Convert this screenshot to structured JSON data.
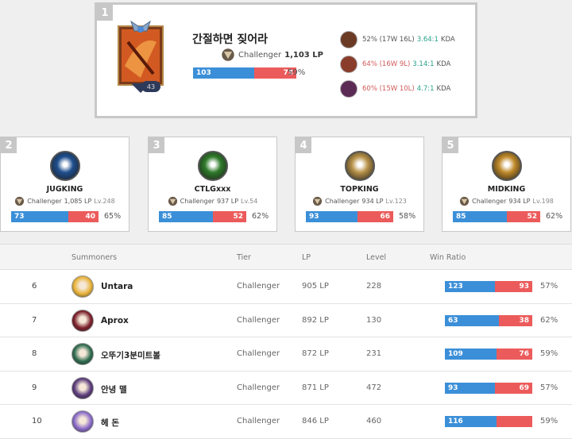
{
  "top1": {
    "rank": "1",
    "name": "간절하면 짖어라",
    "tier": "Challenger",
    "lp": "1,103 LP",
    "level": "43",
    "wins": "103",
    "losses": "73",
    "win_fraction": 0.585,
    "win_ratio": "59%",
    "most_played": [
      {
        "record": "52% (17W 16L)",
        "kda": "3.64:1",
        "kda_suffix": "KDA",
        "champ_color": "#6b3a24",
        "red": false
      },
      {
        "record": "64% (16W 9L)",
        "kda": "3.14:1",
        "kda_suffix": "KDA",
        "champ_color": "#8a3d2a",
        "red": true
      },
      {
        "record": "60% (15W 10L)",
        "kda": "4.7:1",
        "kda_suffix": "KDA",
        "champ_color": "#5b2a55",
        "red": true
      }
    ]
  },
  "top_cards": [
    {
      "rank": "2",
      "name": "JUGKING",
      "tier": "Challenger",
      "lp": "1,085 LP",
      "lv": "Lv.248",
      "wins": "73",
      "losses": "40",
      "win_fraction": 0.646,
      "win_ratio": "65%",
      "icon_color": "#1f4f8e"
    },
    {
      "rank": "3",
      "name": "CTLGxxx",
      "tier": "Challenger",
      "lp": "937 LP",
      "lv": "Lv.54",
      "wins": "85",
      "losses": "52",
      "win_fraction": 0.62,
      "win_ratio": "62%",
      "icon_color": "#2f7a2a"
    },
    {
      "rank": "4",
      "name": "TOPKING",
      "tier": "Challenger",
      "lp": "934 LP",
      "lv": "Lv.123",
      "wins": "93",
      "losses": "66",
      "win_fraction": 0.585,
      "win_ratio": "58%",
      "icon_color": "#b8934a"
    },
    {
      "rank": "5",
      "name": "MIDKING",
      "tier": "Challenger",
      "lp": "934 LP",
      "lv": "Lv.198",
      "wins": "85",
      "losses": "52",
      "win_fraction": 0.62,
      "win_ratio": "62%",
      "icon_color": "#c08a2a"
    }
  ],
  "table": {
    "headers": {
      "summoners": "Summoners",
      "tier": "Tier",
      "lp": "LP",
      "level": "Level",
      "win_ratio": "Win Ratio"
    },
    "rows": [
      {
        "rank": "6",
        "name": "Untara",
        "tier": "Challenger",
        "lp": "905 LP",
        "level": "228",
        "wins": "123",
        "losses": "93",
        "win_fraction": 0.57,
        "ratio": "57%",
        "avatar_color": "#e8b33a"
      },
      {
        "rank": "7",
        "name": "Aprox",
        "tier": "Challenger",
        "lp": "892 LP",
        "level": "130",
        "wins": "63",
        "losses": "38",
        "win_fraction": 0.624,
        "ratio": "62%",
        "avatar_color": "#7a1f2a"
      },
      {
        "rank": "8",
        "name": "오뚜기3분미트볼",
        "tier": "Challenger",
        "lp": "872 LP",
        "level": "231",
        "wins": "109",
        "losses": "76",
        "win_fraction": 0.589,
        "ratio": "59%",
        "avatar_color": "#2e6b4e"
      },
      {
        "rank": "9",
        "name": "안녕 맬",
        "tier": "Challenger",
        "lp": "871 LP",
        "level": "472",
        "wins": "93",
        "losses": "69",
        "win_fraction": 0.574,
        "ratio": "57%",
        "avatar_color": "#5a3a7a"
      },
      {
        "rank": "10",
        "name": "헤 돈",
        "tier": "Challenger",
        "lp": "846 LP",
        "level": "460",
        "wins": "116",
        "losses": "",
        "win_fraction": 0.59,
        "ratio": "59%",
        "avatar_color": "#8a6bc8"
      }
    ]
  },
  "colors": {
    "win": "#3b8fd8",
    "loss": "#ec5b5b",
    "kda": "#27a087"
  }
}
